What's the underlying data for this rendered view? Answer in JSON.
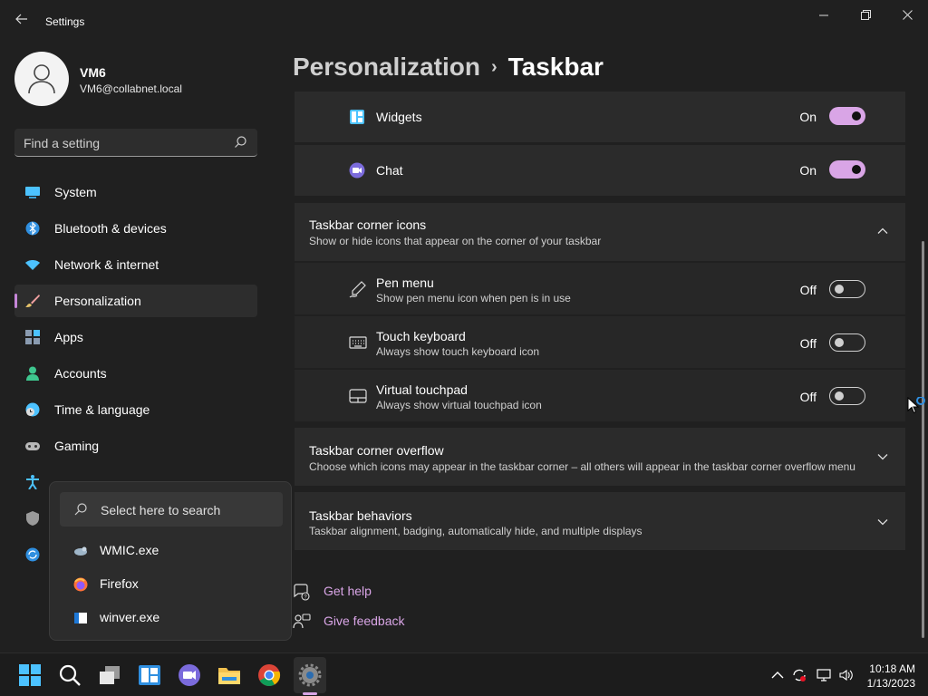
{
  "window": {
    "app_title": "Settings",
    "back_icon": "back-arrow-icon",
    "controls": [
      "minimize",
      "restore",
      "close"
    ]
  },
  "profile": {
    "name": "VM6",
    "email": "VM6@collabnet.local"
  },
  "search": {
    "placeholder": "Find a setting"
  },
  "sidebar": {
    "items": [
      {
        "label": "System",
        "icon": "system-icon",
        "active": false
      },
      {
        "label": "Bluetooth & devices",
        "icon": "bluetooth-icon",
        "active": false
      },
      {
        "label": "Network & internet",
        "icon": "wifi-icon",
        "active": false
      },
      {
        "label": "Personalization",
        "icon": "brush-icon",
        "active": true
      },
      {
        "label": "Apps",
        "icon": "apps-icon",
        "active": false
      },
      {
        "label": "Accounts",
        "icon": "accounts-icon",
        "active": false
      },
      {
        "label": "Time & language",
        "icon": "clock-globe-icon",
        "active": false
      },
      {
        "label": "Gaming",
        "icon": "gamepad-icon",
        "active": false
      }
    ]
  },
  "breadcrumb": {
    "parent": "Personalization",
    "separator": "›",
    "current": "Taskbar"
  },
  "taskbar_items": {
    "widgets": {
      "title": "Widgets",
      "state": "On"
    },
    "chat": {
      "title": "Chat",
      "state": "On"
    }
  },
  "corner_icons": {
    "title": "Taskbar corner icons",
    "desc": "Show or hide icons that appear on the corner of your taskbar",
    "items": [
      {
        "title": "Pen menu",
        "desc": "Show pen menu icon when pen is in use",
        "state": "Off"
      },
      {
        "title": "Touch keyboard",
        "desc": "Always show touch keyboard icon",
        "state": "Off"
      },
      {
        "title": "Virtual touchpad",
        "desc": "Always show virtual touchpad icon",
        "state": "Off"
      }
    ]
  },
  "corner_overflow": {
    "title": "Taskbar corner overflow",
    "desc": "Choose which icons may appear in the taskbar corner – all others will appear in the taskbar corner overflow menu"
  },
  "behaviors": {
    "title": "Taskbar behaviors",
    "desc": "Taskbar alignment, badging, automatically hide, and multiple displays"
  },
  "links": {
    "help": "Get help",
    "feedback": "Give feedback"
  },
  "popup": {
    "search_placeholder": "Select here to search",
    "items": [
      "WMIC.exe",
      "Firefox",
      "winver.exe"
    ]
  },
  "clock": {
    "time": "10:18 AM",
    "date": "1/13/2023"
  },
  "colors": {
    "accent": "#d9a5e6",
    "background": "#202020",
    "card": "#2b2b2b"
  }
}
